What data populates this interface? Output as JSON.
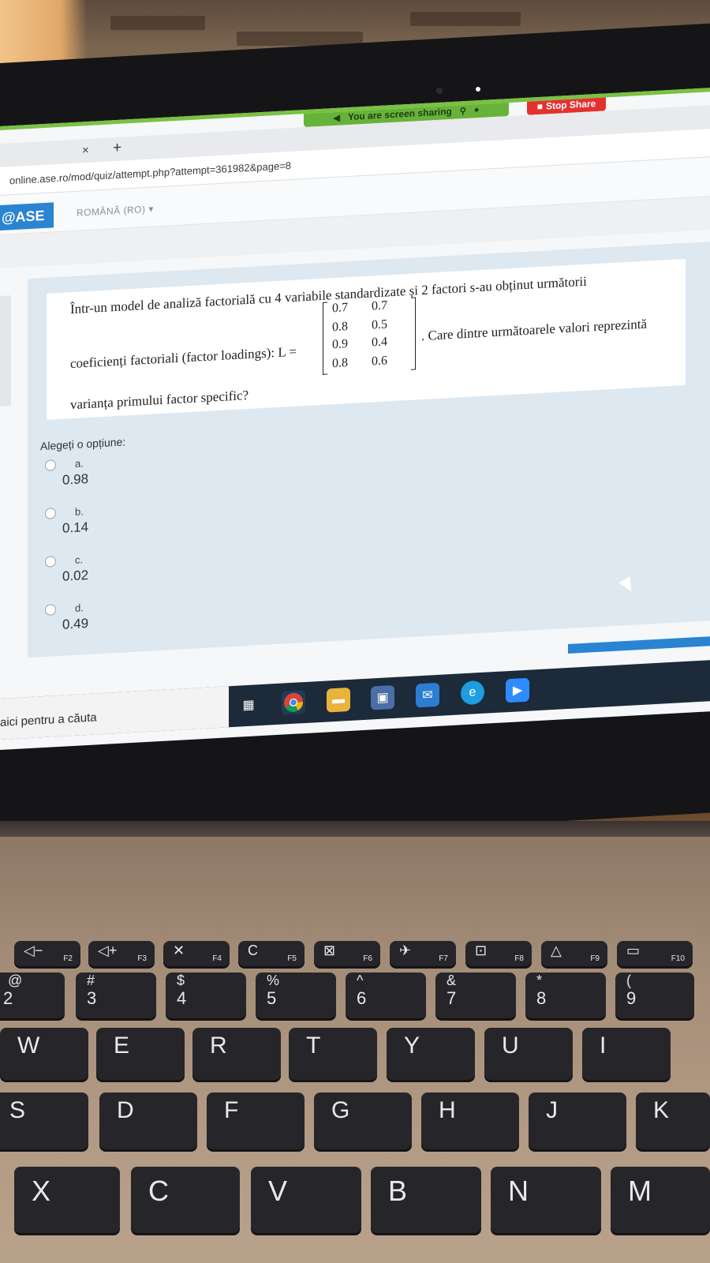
{
  "browser": {
    "share_banner": "You are screen sharing",
    "stop_share": "Stop Share",
    "tab_close": "×",
    "new_tab": "+",
    "url": "online.ase.ro/mod/quiz/attempt.php?attempt=361982&page=8"
  },
  "site": {
    "brand": "@ASE",
    "language": "ROMÂNĂ (RO)",
    "language_caret": "▾"
  },
  "question": {
    "line1": "Într-un model de analiză factorială cu 4 variabile standardizate și 2 factori s-au obținut următorii",
    "line2_prefix": "coeficienți factoriali (factor loadings): L =",
    "line2_suffix": ". Care dintre următoarele valori reprezintă",
    "line3": "varianța primului factor specific?",
    "matrix": [
      [
        "0.7",
        "0.7"
      ],
      [
        "0.8",
        "0.5"
      ],
      [
        "0.9",
        "0.4"
      ],
      [
        "0.8",
        "0.6"
      ]
    ]
  },
  "answer": {
    "prompt": "Alegeți o opțiune:",
    "options": [
      {
        "letter": "a.",
        "value": "0.98"
      },
      {
        "letter": "b.",
        "value": "0.14"
      },
      {
        "letter": "c.",
        "value": "0.02"
      },
      {
        "letter": "d.",
        "value": "0.49"
      }
    ]
  },
  "taskbar": {
    "search_text": "aici pentru a căuta"
  },
  "keyboard": {
    "fn_row": [
      {
        "icon": "◁−",
        "fn": "F2"
      },
      {
        "icon": "◁+",
        "fn": "F3"
      },
      {
        "icon": "✕",
        "fn": "F4"
      },
      {
        "icon": "C",
        "fn": "F5"
      },
      {
        "icon": "⊠",
        "fn": "F6"
      },
      {
        "icon": "✈",
        "fn": "F7"
      },
      {
        "icon": "⊡",
        "fn": "F8"
      },
      {
        "icon": "△",
        "fn": "F9"
      },
      {
        "icon": "▭",
        "fn": "F10"
      }
    ],
    "num_row": [
      {
        "sym": "@",
        "num": "2"
      },
      {
        "sym": "#",
        "num": "3"
      },
      {
        "sym": "$",
        "num": "4"
      },
      {
        "sym": "%",
        "num": "5"
      },
      {
        "sym": "^",
        "num": "6"
      },
      {
        "sym": "&",
        "num": "7"
      },
      {
        "sym": "*",
        "num": "8"
      },
      {
        "sym": "(",
        "num": "9"
      }
    ],
    "row_q": [
      "W",
      "E",
      "R",
      "T",
      "Y",
      "U",
      "I"
    ],
    "row_a": [
      "S",
      "D",
      "F",
      "G",
      "H",
      "J",
      "K"
    ],
    "row_z": [
      "X",
      "C",
      "V",
      "B",
      "N",
      "M"
    ]
  }
}
